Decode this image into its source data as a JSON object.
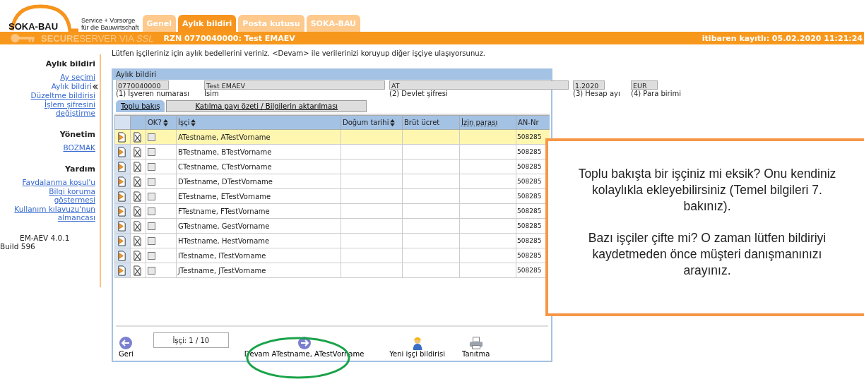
{
  "logo": {
    "name": "SOKA-BAU",
    "tagline_1": "Service + Vorsorge",
    "tagline_2": "für die Bauwirtschaft"
  },
  "tabs": [
    {
      "label": "Genel",
      "selected": false
    },
    {
      "label": "Aylık bildiri",
      "selected": true
    },
    {
      "label": "Posta kutusu",
      "selected": false
    },
    {
      "label": "SOKA-BAU",
      "selected": false
    }
  ],
  "status_bar": {
    "secure_label": "**SECURE**SERVER VIA *SSL*",
    "account": "RZN 0770040000: Test EMAEV",
    "login_time": "itibaren kayıtlı:  05.02.2020 11:21:24"
  },
  "instruction": "Lütfen işçileriniz için aylık bedellerini veriniz. <Devam> ile verilerinizi koruyup diğer işçiye ulaşıyorsunuz.",
  "sidebar": {
    "sections": [
      {
        "title": "Aylık bildiri",
        "items": [
          {
            "label": "Ay seçimi",
            "selected": false
          },
          {
            "label": "Aylık bildiri",
            "selected": true
          },
          {
            "label": "Düzeltme bildirisi",
            "selected": false
          },
          {
            "label": "İşlem şifresini değiştirme",
            "selected": false
          }
        ]
      },
      {
        "title": "Yönetim",
        "items": [
          {
            "label": "BOZMAK",
            "selected": false
          }
        ]
      },
      {
        "title": "Yardım",
        "items": [
          {
            "label": "Faydalanma koşul'u",
            "selected": false
          },
          {
            "label": "Bilgi koruma göstermesi",
            "selected": false
          },
          {
            "label": "Kullanım kılavuzu'nun almancası",
            "selected": false
          }
        ]
      }
    ],
    "version": "EM-AEV 4.0.1",
    "build": "Build 596"
  },
  "panel": {
    "title": "Aylık bildiri",
    "fields": [
      {
        "value": "0770040000",
        "label": "(1) İşveren numarası"
      },
      {
        "value": "Test EMAEV",
        "label": "İsim"
      },
      {
        "value": "AT",
        "label": "(2) Devlet şifresi"
      },
      {
        "value": "1.2020",
        "label": "(3) Hesap ayı"
      },
      {
        "value": "EUR",
        "label": "(4) Para birimi"
      }
    ],
    "subtabs": [
      {
        "label": "Toplu bakış",
        "selected": true
      },
      {
        "label": "Katılma payı özeti / Bilgilerin aktarılması",
        "selected": false
      }
    ],
    "table": {
      "columns": [
        {
          "label": "OK?",
          "sortable": true
        },
        {
          "label": "İşçi",
          "sortable": true
        },
        {
          "label": "Doğum tarihi",
          "sortable": true
        },
        {
          "label": "Brüt ücret",
          "sortable": false
        },
        {
          "label": "İzin parası",
          "sortable": false
        },
        {
          "label": "AN-Nr",
          "sortable": false
        }
      ],
      "rows": [
        {
          "name": "ATestname, ATestVorname",
          "an_nr": "508285",
          "checked": false,
          "selected": true
        },
        {
          "name": "BTestname, BTestVorname",
          "an_nr": "508285",
          "checked": false,
          "selected": false
        },
        {
          "name": "CTestname, CTestVorname",
          "an_nr": "508285",
          "checked": false,
          "selected": false
        },
        {
          "name": "DTestname, DTestVorname",
          "an_nr": "508285",
          "checked": false,
          "selected": false
        },
        {
          "name": "ETestname, ETestVorname",
          "an_nr": "508285",
          "checked": false,
          "selected": false
        },
        {
          "name": "FTestname, FTestVorname",
          "an_nr": "508285",
          "checked": false,
          "selected": false
        },
        {
          "name": "GTestname, GestVorname",
          "an_nr": "508285",
          "checked": false,
          "selected": false
        },
        {
          "name": "HTestname, HestVorname",
          "an_nr": "508285",
          "checked": false,
          "selected": false
        },
        {
          "name": "ITestname, ITestVorname",
          "an_nr": "508285",
          "checked": false,
          "selected": false
        },
        {
          "name": "JTestname, JTestVorname",
          "an_nr": "508285",
          "checked": false,
          "selected": false
        }
      ]
    },
    "footer": {
      "back": "Geri",
      "counter": "İşçi:  1 / 10",
      "next": "Devam ATestname, ATestVorname",
      "new_worker": "Yeni işçi bildirisi",
      "print": "Tanıtma"
    }
  },
  "callout": {
    "paragraphs": [
      "Toplu bakışta bir işçiniz mi eksik? Onu kendiniz kolaylıkla ekleyebilirsiniz (Temel bilgileri 7. bakınız).",
      "Bazı işçiler çifte mi? O zaman lütfen bildiriyi kaydetmeden önce müşteri danışmanınızı arayınız."
    ]
  }
}
